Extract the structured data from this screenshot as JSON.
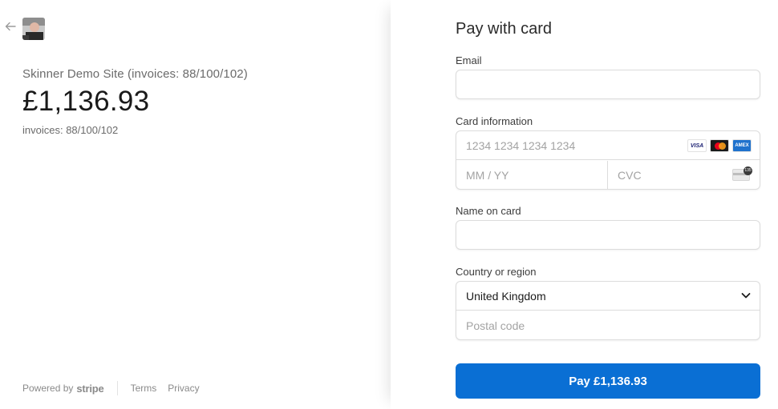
{
  "summary": {
    "merchant_name": "Skinner Demo Site (invoices: 88/100/102)",
    "amount": "£1,136.93",
    "description": "invoices: 88/100/102"
  },
  "footer": {
    "powered_by": "Powered by",
    "brand": "stripe",
    "terms": "Terms",
    "privacy": "Privacy"
  },
  "form": {
    "title": "Pay with card",
    "email_label": "Email",
    "email_value": "",
    "card_label": "Card information",
    "card_number_placeholder": "1234 1234 1234 1234",
    "expiry_placeholder": "MM / YY",
    "cvc_placeholder": "CVC",
    "cvc_badge": "135",
    "card_brands": [
      "VISA",
      "mastercard",
      "AMEX"
    ],
    "name_label": "Name on card",
    "name_value": "",
    "country_label": "Country or region",
    "country_value": "United Kingdom",
    "postal_placeholder": "Postal code",
    "pay_button": "Pay £1,136.93"
  },
  "colors": {
    "pay_button": "#0a6fd4",
    "text_primary": "#1a1a1a",
    "text_secondary": "#6b6b6b",
    "border": "#dcdcdc"
  },
  "icons": {
    "back": "arrow-left-icon",
    "dropdown": "chevron-down-icon"
  }
}
